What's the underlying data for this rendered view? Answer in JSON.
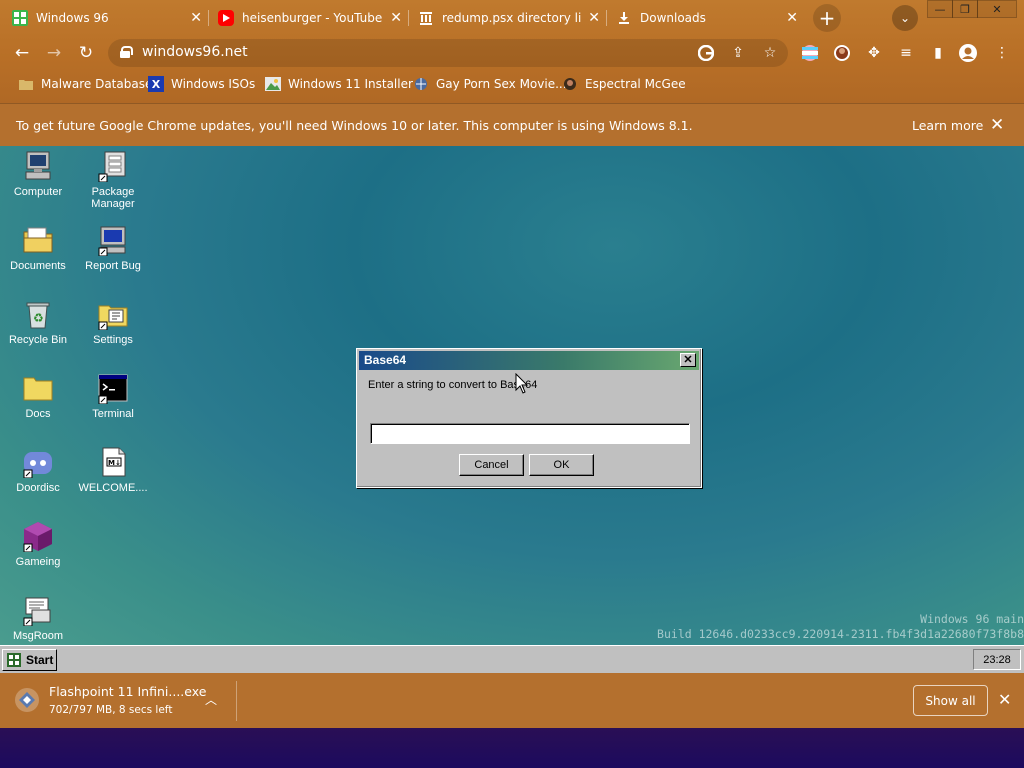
{
  "browser": {
    "tabs": [
      {
        "title": "Windows 96",
        "icon": "windows96-favicon",
        "color": "#3ab54a"
      },
      {
        "title": "heisenburger - YouTube",
        "icon": "youtube-favicon",
        "color": "#ff0000"
      },
      {
        "title": "redump.psx directory listi",
        "icon": "archive-favicon",
        "color": "#ffffff"
      },
      {
        "title": "Downloads",
        "icon": "download-icon",
        "color": "#ffffff"
      }
    ],
    "tab_close": "✕",
    "new_tab": "+",
    "url": "windows96.net",
    "bookmarks": [
      {
        "label": "Malware Database",
        "icon": "folder-icon"
      },
      {
        "label": "Windows ISOs",
        "icon": "x-icon"
      },
      {
        "label": "Windows 11 Installer",
        "icon": "image-icon"
      },
      {
        "label": "Gay Porn Sex Movie...",
        "icon": "globe-icon"
      },
      {
        "label": "Espectral McGee",
        "icon": "avatar-icon"
      }
    ],
    "infobar": {
      "message": "To get future Google Chrome updates, you'll need Windows 10 or later. This computer is using Windows 8.1.",
      "learn_more": "Learn more",
      "close": "✕"
    },
    "download": {
      "filename": "Flashpoint 11 Infini....exe",
      "status": "702/797 MB, 8 secs left",
      "show_all": "Show all",
      "close": "✕"
    }
  },
  "desktop": {
    "icons": [
      {
        "label": "Computer",
        "icon": "computer-icon"
      },
      {
        "label": "Package Manager",
        "icon": "package-manager-icon"
      },
      {
        "label": "Documents",
        "icon": "documents-icon"
      },
      {
        "label": "Report Bug",
        "icon": "report-bug-icon"
      },
      {
        "label": "Recycle Bin",
        "icon": "recycle-bin-icon"
      },
      {
        "label": "Settings",
        "icon": "settings-icon"
      },
      {
        "label": "Docs",
        "icon": "folder-icon"
      },
      {
        "label": "Terminal",
        "icon": "terminal-icon"
      },
      {
        "label": "Doordisc",
        "icon": "discord-icon"
      },
      {
        "label": "WELCOME....",
        "icon": "markdown-icon"
      },
      {
        "label": "Gameing",
        "icon": "cube-icon"
      },
      {
        "label": "MsgRoom",
        "icon": "msgroom-icon"
      }
    ],
    "watermark_line1": "Windows 96 main",
    "watermark_line2": "Build 12646.d0233cc9.220914-2311.fb4f3d1a22680f73f8b8"
  },
  "dialog": {
    "title": "Base64",
    "prompt": "Enter a string to convert to Base64",
    "input_value": "",
    "cancel": "Cancel",
    "ok": "OK",
    "close": "✕"
  },
  "taskbar": {
    "start": "Start",
    "clock": "23:28"
  }
}
